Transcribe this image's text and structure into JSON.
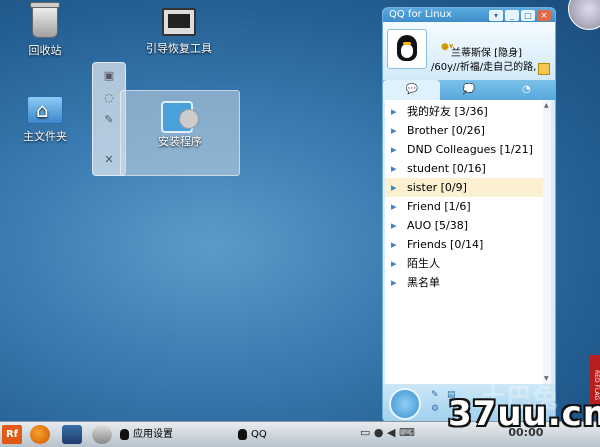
{
  "desktop": {
    "icons": [
      {
        "label": "回收站"
      },
      {
        "label": "引导恢复工具"
      },
      {
        "label": "主文件夹"
      },
      {
        "label": "安装程序"
      }
    ]
  },
  "widget_toolbar": {
    "buttons": [
      "▣",
      "◌",
      "✎",
      "✕"
    ]
  },
  "qq": {
    "window_title": "QQ for Linux",
    "window_buttons": [
      "▾",
      "_",
      "□",
      "✕"
    ],
    "nickname": "兰蒂斯保 [隐身]",
    "signature": "/60y//祈福/走自己的路,",
    "tabs": [
      "💬",
      "💭",
      "◔"
    ],
    "groups": [
      {
        "label": "我的好友 [3/36]"
      },
      {
        "label": "Brother [0/26]"
      },
      {
        "label": "DND Colleagues [1/21]"
      },
      {
        "label": "student [0/16]"
      },
      {
        "label": "sister [0/9]",
        "selected": true
      },
      {
        "label": "Friend [1/6]"
      },
      {
        "label": "AUO [5/38]"
      },
      {
        "label": "Friends [0/14]"
      },
      {
        "label": "陌生人"
      },
      {
        "label": "黑名单"
      }
    ]
  },
  "watermark": {
    "text": "土巴兔",
    "side_tag": "RED FLAG",
    "logo": "37uu.cn"
  },
  "taskbar": {
    "start_label": "Rf",
    "app_settings": "应用设置",
    "qq_task": "QQ",
    "clock": "00:00"
  },
  "colors": {
    "qq_accent": "#3c8dca",
    "selected_row": "#fbf0cf",
    "start": "#e05a16"
  }
}
